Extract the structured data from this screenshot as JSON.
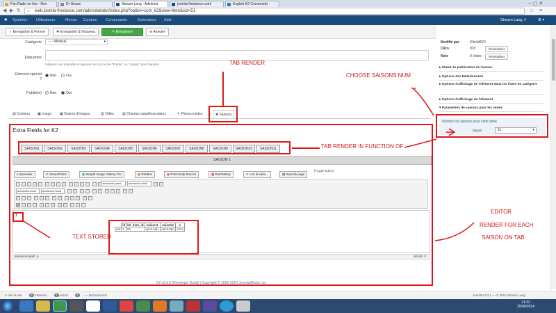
{
  "browser": {
    "tabs": [
      {
        "label": "Fan Radio en live - Rov",
        "color": "#e8a020",
        "active": false
      },
      {
        "label": "Dr House",
        "color": "#888888",
        "active": false
      },
      {
        "label": "Stream Lang - Administ",
        "color": "#1b4b7a",
        "active": true
      },
      {
        "label": "joomla-freelance.com/",
        "color": "#1b4b7a",
        "active": false
      },
      {
        "label": "English K2 Community -",
        "color": "#2a7ab0",
        "active": false
      }
    ],
    "url": "web.joomla-freelance.com/administrator/index.php?option=com_k2&view=item&cid=51"
  },
  "admin_menu": [
    "Système",
    "Utilisateurs",
    "Menus",
    "Contenu",
    "Composants",
    "Extensions",
    "Aide"
  ],
  "site_name": "Stream Lang",
  "toolbar": {
    "save_close": "Enregistrer & Fermer",
    "save_new": "Enregistrer & Nouveau",
    "save": "Enregistrer",
    "cancel": "Annuler"
  },
  "form": {
    "category_label": "Catégorie",
    "category_value": "- - - Médical",
    "tags_label": "Etiquettes",
    "tags_hint": "Indiquez une étiquette et appuyez sur la touche \"Entrée\" ou \"virgule\" pour l'ajouter.",
    "featured_label": "Elément spécial ?",
    "published_label": "Publié(e)",
    "no": "Non",
    "yes": "Oui"
  },
  "content_tabs": [
    "Contenu",
    "Image",
    "Galerie d'images",
    "Vidéo",
    "Champs supplémentaires",
    "Pièces jointes",
    "Saisons"
  ],
  "extra_fields_title": "Extra Fields for K2",
  "season_tabs": [
    "SAISON1",
    "SAISON2",
    "SAISON3",
    "SAISON4",
    "SAISON5",
    "SAISON6",
    "SAISON7",
    "SAISON8",
    "SAISON9",
    "SAISON10",
    "SAISON11"
  ],
  "season_header": "SAISON 1",
  "editor_buttons": [
    "Episodes",
    "Series/Films",
    "Simple Image Gallery Pro",
    "RokBox",
    "RokCandy Macros",
    "RokGallery",
    "Lire la suite...",
    "Saut de page"
  ],
  "toggle_editor": "[Toggle Editor]",
  "font_selects": [
    "advanced.paral",
    "advanced.stvle"
  ],
  "font_selects_row3": [
    "advanced.fonts",
    "advanced.fonts"
  ],
  "stored_table": {
    "headers": [
      "id",
      "k2_item_id",
      "saison1",
      "saison2",
      "s"
    ],
    "row": [
      "car",
      "1",
      "51",
      "<p>1</p>",
      "<p>2</p>",
      "<N a"
    ]
  },
  "editor_path": "advanced.path: p",
  "words": "Words: 0",
  "footer": "K2 v2.6.9 (Developer Build) | Copyright © 2006-2014 JoomlaWorks Ltd.",
  "right_panel": {
    "modified_by_label": "Modifié par",
    "modified_by": "K0n3d970",
    "hits_label": "Clics",
    "hits": "915",
    "reset": "Réinitialiser",
    "rating_label": "Note",
    "rating": "0 Votes",
    "sections": [
      "Statut de publication de l'auteur",
      "Options des Métadonnées",
      "Options d'affichage de l'élément dans les listes de catégorie",
      "Options d'affichage de l'élément",
      "Paramètres de saisons pour les series"
    ],
    "season_count_title": "Nombre de saisons pour cette série",
    "season_select_label": "Saison",
    "season_select_value": "11"
  },
  "annotations": {
    "tab_render": "TAB RENDER",
    "choose_num": "CHOOSE SAISONS NUM",
    "tab_render_function": "TAB RENDER IN FUNCTION OF",
    "editor": "EDITOR",
    "render_each": "RENDER FOR EACH",
    "saison_on_tab": "SAISON ON TAB",
    "text_stored": "TEXT STORED"
  },
  "status_bar": {
    "view_site": "Voir le site",
    "visitors_count": "0",
    "visitors": "Visiteurs",
    "admin_count": "1",
    "admin": "Admin",
    "messages_count": "0",
    "logout": "Déconnexion",
    "version": "Joomla! 3.3.1 — © 2014 Stream Lang"
  },
  "clock": {
    "time": "21:32",
    "date": "25/06/2014"
  }
}
